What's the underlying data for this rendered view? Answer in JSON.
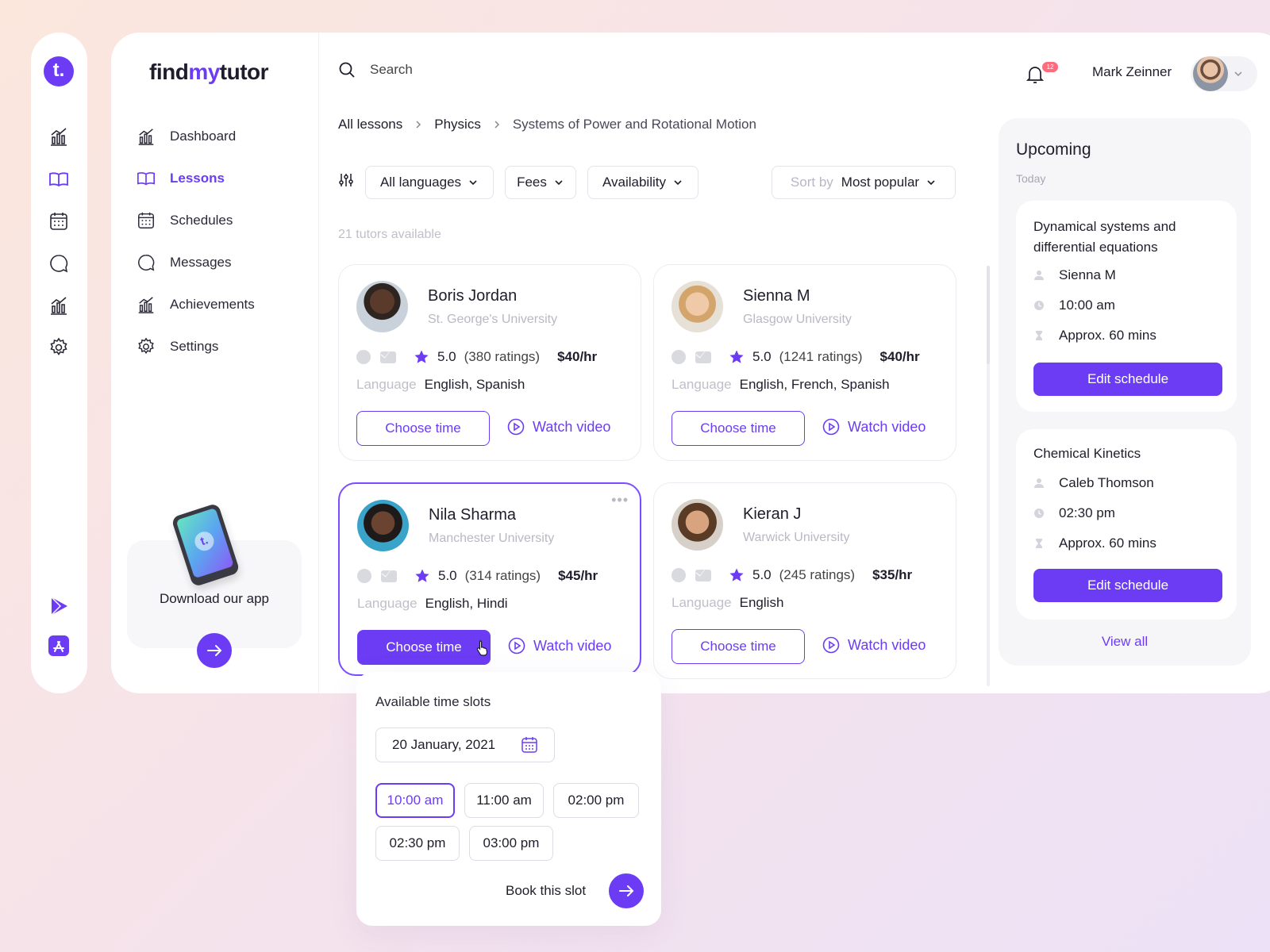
{
  "brand": {
    "prefix": "find",
    "accent": "my",
    "suffix": "tutor",
    "rail_logo": "t."
  },
  "colors": {
    "accent": "#6c3cf5",
    "badge": "#ff6b7d",
    "muted_text": "#b9b8c4"
  },
  "rail": {
    "icons": [
      "chart-icon",
      "book-icon",
      "calendar-icon",
      "message-icon",
      "achievement-icon",
      "gear-icon",
      "play-store-icon",
      "app-store-icon"
    ]
  },
  "nav": {
    "items": [
      {
        "label": "Dashboard",
        "icon": "chart-icon"
      },
      {
        "label": "Lessons",
        "icon": "book-icon",
        "active": true
      },
      {
        "label": "Schedules",
        "icon": "calendar-icon"
      },
      {
        "label": "Messages",
        "icon": "message-icon"
      },
      {
        "label": "Achievements",
        "icon": "achievement-icon"
      },
      {
        "label": "Settings",
        "icon": "gear-icon"
      }
    ]
  },
  "app_promo": {
    "label": "Download our app",
    "phone_logo": "t."
  },
  "header": {
    "search_placeholder": "Search",
    "notification_count": "12",
    "user_name": "Mark Zeinner"
  },
  "breadcrumb": [
    "All lessons",
    "Physics",
    "Systems of Power and Rotational Motion"
  ],
  "filters": {
    "language": "All languages",
    "fees": "Fees",
    "availability": "Availability",
    "sort_label": "Sort by",
    "sort_value": "Most popular"
  },
  "tutors_count": "21 tutors available",
  "tutor_card": {
    "language_label": "Language",
    "choose_time": "Choose time",
    "watch_video": "Watch video"
  },
  "tutors": [
    {
      "name": "Boris Jordan",
      "university": "St. George's University",
      "rating": "5.0",
      "ratings": "(380 ratings)",
      "price": "$40/hr",
      "languages": "English, Spanish"
    },
    {
      "name": "Sienna M",
      "university": "Glasgow University",
      "rating": "5.0",
      "ratings": "(1241 ratings)",
      "price": "$40/hr",
      "languages": "English, French, Spanish"
    },
    {
      "name": "Nila Sharma",
      "university": "Manchester University",
      "rating": "5.0",
      "ratings": "(314 ratings)",
      "price": "$45/hr",
      "languages": "English, Hindi",
      "selected": true
    },
    {
      "name": "Kieran J",
      "university": "Warwick University",
      "rating": "5.0",
      "ratings": "(245 ratings)",
      "price": "$35/hr",
      "languages": "English"
    }
  ],
  "upcoming": {
    "title": "Upcoming",
    "subtitle": "Today",
    "edit_label": "Edit schedule",
    "view_all": "View all",
    "lessons": [
      {
        "title": "Dynamical systems and differential equations",
        "tutor": "Sienna M",
        "time": "10:00 am",
        "duration": "Approx. 60 mins"
      },
      {
        "title": "Chemical Kinetics",
        "tutor": "Caleb Thomson",
        "time": "02:30 pm",
        "duration": "Approx. 60 mins"
      }
    ]
  },
  "time_slots": {
    "title": "Available time slots",
    "date": "20 January, 2021",
    "slots": [
      "10:00 am",
      "11:00 am",
      "02:00 pm",
      "02:30 pm",
      "03:00 pm"
    ],
    "selected": "10:00 am",
    "book_label": "Book this slot"
  }
}
